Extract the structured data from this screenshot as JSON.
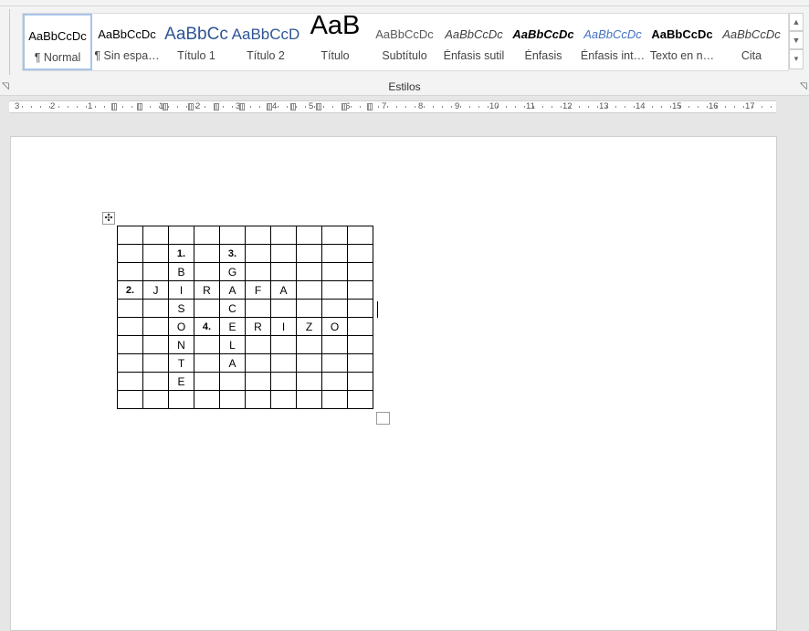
{
  "ribbon": {
    "group_label": "Estilos",
    "styles": [
      {
        "preview": "AaBbCcDc",
        "label": "¶ Normal",
        "selected": true
      },
      {
        "preview": "AaBbCcDc",
        "label": "¶ Sin espa…"
      },
      {
        "preview": "AaBbCc",
        "label": "Título 1"
      },
      {
        "preview": "AaBbCcD",
        "label": "Título 2"
      },
      {
        "preview": "AaB",
        "label": "Título"
      },
      {
        "preview": "AaBbCcDc",
        "label": "Subtítulo"
      },
      {
        "preview": "AaBbCcDc",
        "label": "Énfasis sutil"
      },
      {
        "preview": "AaBbCcDc",
        "label": "Énfasis"
      },
      {
        "preview": "AaBbCcDc",
        "label": "Énfasis int…"
      },
      {
        "preview": "AaBbCcDc",
        "label": "Texto en n…"
      },
      {
        "preview": "AaBbCcDc",
        "label": "Cita"
      }
    ]
  },
  "ruler": {
    "labels": [
      "3",
      "2",
      "1",
      "1",
      "2",
      "3",
      "4",
      "5",
      "6",
      "7",
      "8",
      "9",
      "10",
      "11",
      "12",
      "13",
      "14",
      "15",
      "16",
      "17"
    ]
  },
  "crossword": {
    "rows": [
      [
        "",
        "",
        "",
        "",
        "",
        "",
        "",
        "",
        "",
        ""
      ],
      [
        "",
        "",
        "1.",
        "",
        "3.",
        "",
        "",
        "",
        "",
        ""
      ],
      [
        "",
        "",
        "B",
        "",
        "G",
        "",
        "",
        "",
        "",
        ""
      ],
      [
        "2.",
        "J",
        "I",
        "R",
        "A",
        "F",
        "A",
        "",
        "",
        ""
      ],
      [
        "",
        "",
        "S",
        "",
        "C",
        "",
        "",
        "",
        "",
        ""
      ],
      [
        "",
        "",
        "O",
        "4.",
        "E",
        "R",
        "I",
        "Z",
        "O",
        ""
      ],
      [
        "",
        "",
        "N",
        "",
        "L",
        "",
        "",
        "",
        "",
        ""
      ],
      [
        "",
        "",
        "T",
        "",
        "A",
        "",
        "",
        "",
        "",
        ""
      ],
      [
        "",
        "",
        "E",
        "",
        "",
        "",
        "",
        "",
        "",
        ""
      ],
      [
        "",
        "",
        "",
        "",
        "",
        "",
        "",
        "",
        "",
        ""
      ]
    ]
  },
  "icons": {
    "move_handle": "four-arrows-move-icon",
    "scroll_up": "chevron-up-icon",
    "scroll_down": "chevron-down-icon",
    "more": "gallery-more-icon",
    "launcher": "dialog-launcher-icon"
  }
}
